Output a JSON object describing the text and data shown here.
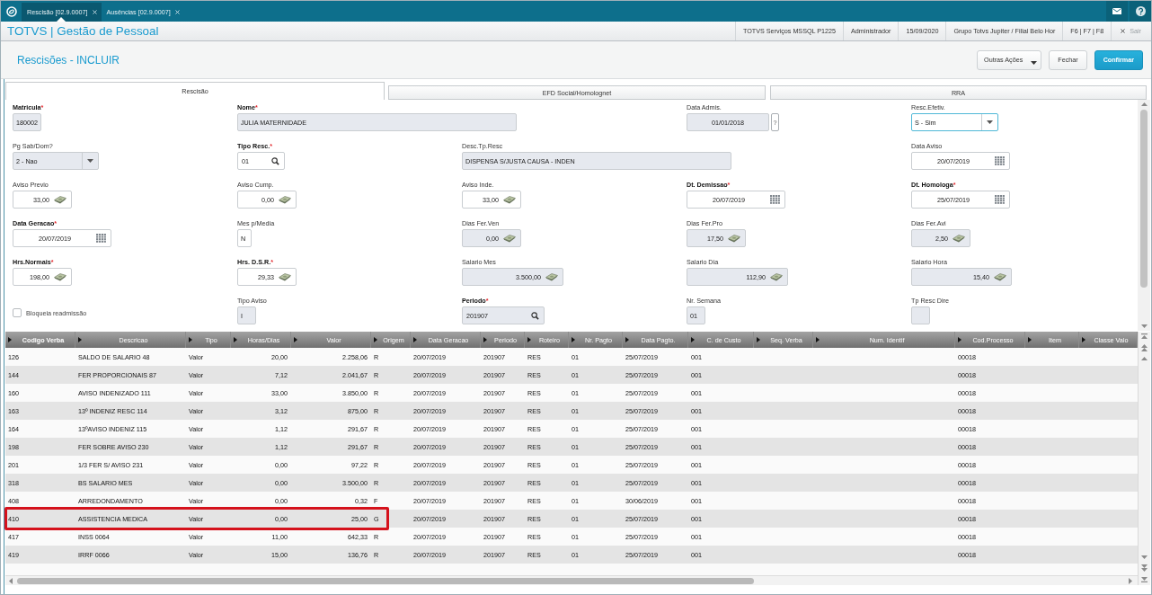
{
  "app_tabs": [
    {
      "label": "Rescisão [02.9.0007]",
      "selected": true
    },
    {
      "label": "Ausências [02.9.0007]",
      "selected": false
    }
  ],
  "header": {
    "title": "TOTVS | Gestão de Pessoal",
    "info": [
      "TOTVS Serviços MSSQL P1225",
      "Administrador",
      "15/09/2020",
      "Grupo Totvs Jupiter / Filial Belo Hor",
      "F6 | F7 | F8"
    ],
    "exit": "Sair"
  },
  "page": {
    "title": "Rescisões - INCLUIR",
    "buttons": [
      {
        "label": "Outras Ações",
        "kind": "menu"
      },
      {
        "label": "Fechar",
        "kind": "default"
      },
      {
        "label": "Confirmar",
        "kind": "primary"
      }
    ]
  },
  "form_tabs": [
    {
      "label": "Rescisão",
      "selected": true
    },
    {
      "label": "EFD Social/Homolognet",
      "selected": false
    },
    {
      "label": "RRA",
      "selected": false
    }
  ],
  "form": {
    "rows": [
      [
        {
          "kind": "text",
          "label": "Matricula",
          "required": true,
          "required_mark": "*",
          "value": "180002",
          "disabled": true,
          "focused": false
        },
        {
          "kind": "long_text",
          "label": "Nome",
          "required": true,
          "required_mark": "*",
          "value": "JULIA MATERNIDADE",
          "disabled": true,
          "focused": false
        },
        "",
        {
          "kind": "date",
          "label": "Data Admis.",
          "required": false,
          "value": "01/01/2018",
          "help": "?",
          "disabled": true,
          "focused": false
        },
        {
          "kind": "select",
          "label": "Resc.Efetiv.",
          "required": false,
          "value": "S - Sim",
          "disabled": false,
          "focused": true
        }
      ],
      [
        {
          "kind": "select",
          "label": "Pg Sab/Dom?",
          "required": false,
          "value": "2 - Nao",
          "disabled": true,
          "focused": false
        },
        {
          "kind": "lookup",
          "label": "Tipo Resc.",
          "required": true,
          "required_mark": "*",
          "value": "01",
          "disabled": false,
          "focused": false
        },
        {
          "kind": "long_text",
          "label": "Desc.Tp.Resc",
          "required": false,
          "value": "DISPENSA S/JUSTA CAUSA - INDEN",
          "disabled": true,
          "focused": false
        },
        "",
        {
          "kind": "date",
          "label": "Data Aviso",
          "required": false,
          "value": "20/07/2019",
          "disabled": false,
          "focused": false
        }
      ],
      [
        {
          "kind": "number",
          "label": "Aviso Previo",
          "required": false,
          "value": "33,00",
          "disabled": false,
          "focused": false
        },
        {
          "kind": "number",
          "label": "Aviso Cump.",
          "required": false,
          "value": "0,00",
          "disabled": false,
          "focused": false
        },
        {
          "kind": "number",
          "label": "Aviso Inde.",
          "required": false,
          "value": "33,00",
          "disabled": false,
          "focused": false
        },
        {
          "kind": "date",
          "label": "Dt. Demissao",
          "required": true,
          "required_mark": "*",
          "value": "20/07/2019",
          "disabled": false,
          "focused": false
        },
        {
          "kind": "date",
          "label": "Dt. Homologa",
          "required": true,
          "required_mark": "*",
          "value": "25/07/2019",
          "disabled": false,
          "focused": false
        }
      ],
      [
        {
          "kind": "date",
          "label": "Data Geracao",
          "required": true,
          "required_mark": "*",
          "value": "20/07/2019",
          "disabled": false,
          "focused": false
        },
        {
          "kind": "text",
          "label": "Mes p/Media",
          "required": false,
          "value": "N",
          "disabled": false,
          "focused": false
        },
        {
          "kind": "number",
          "label": "Dias Fer.Ven",
          "required": false,
          "value": "0,00",
          "disabled": true,
          "focused": false
        },
        {
          "kind": "number",
          "label": "Dias Fer.Pro",
          "required": false,
          "value": "17,50",
          "disabled": true,
          "focused": false
        },
        {
          "kind": "number",
          "label": "Dias Fer.Avi",
          "required": false,
          "value": "2,50",
          "disabled": true,
          "focused": false
        }
      ],
      [
        {
          "kind": "number",
          "label": "Hrs.Normais",
          "required": true,
          "required_mark": "*",
          "value": "198,00",
          "disabled": false,
          "focused": false
        },
        {
          "kind": "number",
          "label": "Hrs. D.S.R.",
          "required": true,
          "required_mark": "*",
          "value": "29,33",
          "disabled": false,
          "focused": false
        },
        {
          "kind": "currency",
          "label": "Salario Mes",
          "required": false,
          "value": "3.500,00",
          "disabled": true,
          "focused": false
        },
        {
          "kind": "currency",
          "label": "Salario Dia",
          "required": false,
          "value": "112,90",
          "disabled": true,
          "focused": false
        },
        {
          "kind": "currency",
          "label": "Salario Hora",
          "required": false,
          "value": "15,40",
          "disabled": true,
          "focused": false
        }
      ],
      [
        {
          "kind": "checkbox",
          "label": "Bloqueia readmissão",
          "checked": false
        },
        {
          "kind": "text",
          "label": "Tipo Aviso",
          "required": false,
          "value": "I",
          "disabled": true,
          "focused": false
        },
        {
          "kind": "lookup",
          "label": "Periodo",
          "required": true,
          "required_mark": "*",
          "value": "201907",
          "disabled": true,
          "focused": false
        },
        {
          "kind": "text",
          "label": "Nr. Semana",
          "required": false,
          "value": "01",
          "disabled": true,
          "focused": false
        },
        {
          "kind": "text",
          "label": "Tp Resc Dire",
          "required": false,
          "disabled": true,
          "focused": false
        }
      ]
    ]
  },
  "table": {
    "columns": [
      {
        "label": "Codigo Verba",
        "sorted": true
      },
      {
        "label": "Descricao",
        "sorted": false
      },
      {
        "label": "Tipo",
        "sorted": false
      },
      {
        "label": "Horas/Dias",
        "sorted": false
      },
      {
        "label": "Valor",
        "sorted": false
      },
      {
        "label": "Origem",
        "sorted": false
      },
      {
        "label": "Data Geracao",
        "sorted": false
      },
      {
        "label": "Periodo",
        "sorted": false
      },
      {
        "label": "Roteiro",
        "sorted": false
      },
      {
        "label": "Nr. Pagto",
        "sorted": false
      },
      {
        "label": "Data Pagto.",
        "sorted": false
      },
      {
        "label": "C. de Custo",
        "sorted": false
      },
      {
        "label": "Seq. Verba",
        "sorted": false
      },
      {
        "label": "Num. Identif",
        "sorted": false
      },
      {
        "label": "Cod.Processo",
        "sorted": false
      },
      {
        "label": "Item",
        "sorted": false
      },
      {
        "label": "Classe Valo",
        "sorted": false
      }
    ],
    "rows": [
      {
        "codigo_verba": "126",
        "descricao": "SALDO DE SALARIO 48",
        "tipo": "Valor",
        "horas_dias": "20,00",
        "valor": "2.258,06",
        "origem": "R",
        "data_geracao": "20/07/2019",
        "periodo": "201907",
        "roteiro": "RES",
        "nr_pagto": "01",
        "data_pagto": "25/07/2019",
        "c_de_custo": "001",
        "cod_processo": "00018",
        "highlighted": false
      },
      {
        "codigo_verba": "144",
        "descricao": "FER PROPORCIONAIS 87",
        "tipo": "Valor",
        "horas_dias": "7,12",
        "valor": "2.041,67",
        "origem": "R",
        "data_geracao": "20/07/2019",
        "periodo": "201907",
        "roteiro": "RES",
        "nr_pagto": "01",
        "data_pagto": "25/07/2019",
        "c_de_custo": "001",
        "cod_processo": "00018",
        "highlighted": false
      },
      {
        "codigo_verba": "160",
        "descricao": "AVISO INDENIZADO 111",
        "tipo": "Valor",
        "horas_dias": "33,00",
        "valor": "3.850,00",
        "origem": "R",
        "data_geracao": "20/07/2019",
        "periodo": "201907",
        "roteiro": "RES",
        "nr_pagto": "01",
        "data_pagto": "25/07/2019",
        "c_de_custo": "001",
        "cod_processo": "00018",
        "highlighted": false
      },
      {
        "codigo_verba": "163",
        "descricao": "13º INDENIZ RESC 114",
        "tipo": "Valor",
        "horas_dias": "3,12",
        "valor": "875,00",
        "origem": "R",
        "data_geracao": "20/07/2019",
        "periodo": "201907",
        "roteiro": "RES",
        "nr_pagto": "01",
        "data_pagto": "25/07/2019",
        "c_de_custo": "001",
        "cod_processo": "00018",
        "highlighted": false
      },
      {
        "codigo_verba": "164",
        "descricao": "13ºAVISO INDENIZ 115",
        "tipo": "Valor",
        "horas_dias": "1,12",
        "valor": "291,67",
        "origem": "R",
        "data_geracao": "20/07/2019",
        "periodo": "201907",
        "roteiro": "RES",
        "nr_pagto": "01",
        "data_pagto": "25/07/2019",
        "c_de_custo": "001",
        "cod_processo": "00018",
        "highlighted": false
      },
      {
        "codigo_verba": "198",
        "descricao": "FER SOBRE AVISO 230",
        "tipo": "Valor",
        "horas_dias": "1,12",
        "valor": "291,67",
        "origem": "R",
        "data_geracao": "20/07/2019",
        "periodo": "201907",
        "roteiro": "RES",
        "nr_pagto": "01",
        "data_pagto": "25/07/2019",
        "c_de_custo": "001",
        "cod_processo": "00018",
        "highlighted": false
      },
      {
        "codigo_verba": "201",
        "descricao": "1/3 FER S/ AVISO 231",
        "tipo": "Valor",
        "horas_dias": "0,00",
        "valor": "97,22",
        "origem": "R",
        "data_geracao": "20/07/2019",
        "periodo": "201907",
        "roteiro": "RES",
        "nr_pagto": "01",
        "data_pagto": "25/07/2019",
        "c_de_custo": "001",
        "cod_processo": "00018",
        "highlighted": false
      },
      {
        "codigo_verba": "318",
        "descricao": "BS SALARIO MES",
        "tipo": "Valor",
        "horas_dias": "0,00",
        "valor": "3.500,00",
        "origem": "R",
        "data_geracao": "20/07/2019",
        "periodo": "201907",
        "roteiro": "RES",
        "nr_pagto": "01",
        "data_pagto": "25/07/2019",
        "c_de_custo": "001",
        "cod_processo": "00018",
        "highlighted": false
      },
      {
        "codigo_verba": "408",
        "descricao": "ARREDONDAMENTO",
        "tipo": "Valor",
        "horas_dias": "0,00",
        "valor": "0,32",
        "origem": "F",
        "data_geracao": "20/07/2019",
        "periodo": "201907",
        "roteiro": "RES",
        "nr_pagto": "01",
        "data_pagto": "30/06/2019",
        "c_de_custo": "001",
        "cod_processo": "00018",
        "highlighted": false
      },
      {
        "codigo_verba": "410",
        "descricao": "ASSISTENCIA MEDICA",
        "tipo": "Valor",
        "horas_dias": "0,00",
        "valor": "25,00",
        "origem": "G",
        "data_geracao": "20/07/2019",
        "periodo": "201907",
        "roteiro": "RES",
        "nr_pagto": "01",
        "data_pagto": "25/07/2019",
        "c_de_custo": "001",
        "cod_processo": "00018",
        "highlighted": true
      },
      {
        "codigo_verba": "417",
        "descricao": "INSS 0064",
        "tipo": "Valor",
        "horas_dias": "11,00",
        "valor": "642,33",
        "origem": "R",
        "data_geracao": "20/07/2019",
        "periodo": "201907",
        "roteiro": "RES",
        "nr_pagto": "01",
        "data_pagto": "25/07/2019",
        "c_de_custo": "001",
        "cod_processo": "00018",
        "highlighted": false
      },
      {
        "codigo_verba": "419",
        "descricao": "IRRF 0066",
        "tipo": "Valor",
        "horas_dias": "15,00",
        "valor": "136,76",
        "origem": "R",
        "data_geracao": "20/07/2019",
        "periodo": "201907",
        "roteiro": "RES",
        "nr_pagto": "01",
        "data_pagto": "25/07/2019",
        "c_de_custo": "001",
        "cod_processo": "00018",
        "highlighted": false
      }
    ]
  }
}
